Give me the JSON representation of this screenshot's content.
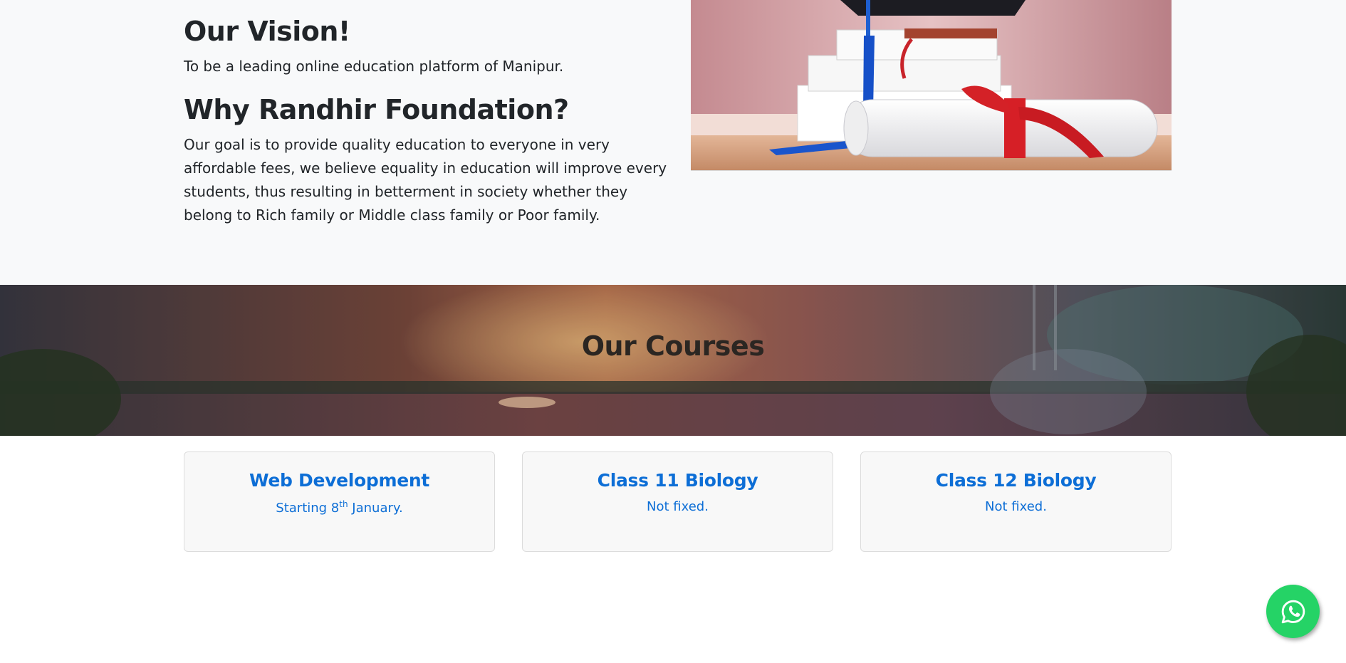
{
  "about": {
    "vision_title": "Our Vision!",
    "vision_text": "To be a leading online education platform of Manipur.",
    "why_title": "Why Randhir Foundation?",
    "why_text": "Our goal is to provide quality education to everyone in very affordable fees, we believe equality in education will improve every students, thus resulting in betterment in society whether they belong to Rich family or Middle class family or Poor family."
  },
  "courses": {
    "title": "Our Courses",
    "items": [
      {
        "title": "Web Development",
        "subtitle_pre": "Starting 8",
        "subtitle_sup": "th",
        "subtitle_post": " January."
      },
      {
        "title": "Class 11 Biology",
        "subtitle": "Not fixed."
      },
      {
        "title": "Class 12 Biology",
        "subtitle": "Not fixed."
      }
    ]
  },
  "icons": {
    "whatsapp": "whatsapp-icon"
  },
  "colors": {
    "accent": "#0d6ed6",
    "whatsapp": "#25d366",
    "section_bg": "#f8f9fa"
  }
}
